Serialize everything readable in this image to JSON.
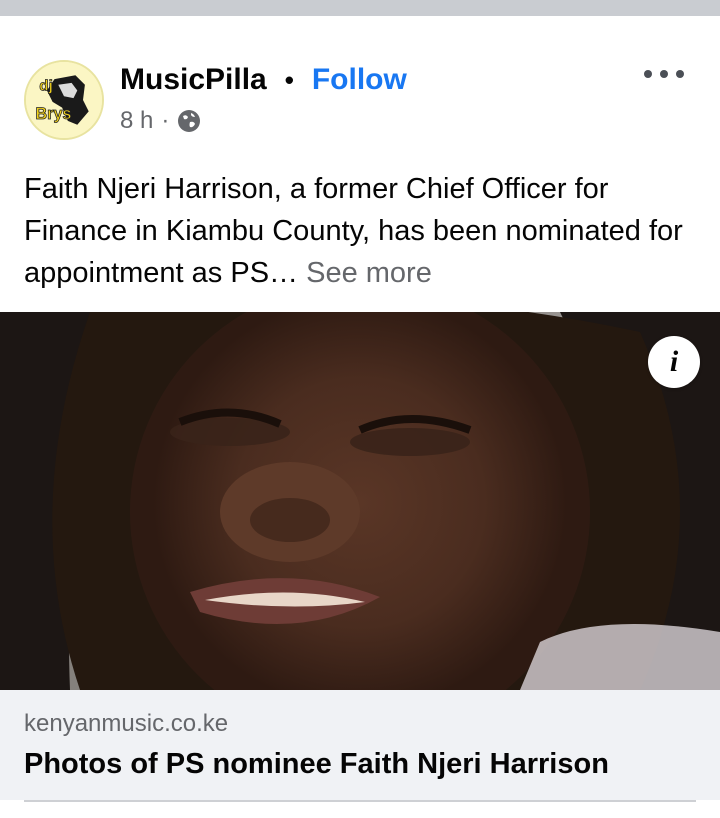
{
  "post": {
    "author": "MusicPilla",
    "separator": "•",
    "follow_label": "Follow",
    "timestamp": "8 h",
    "meta_separator": "·",
    "privacy_icon": "globe-icon",
    "more_icon": "more-horizontal-icon",
    "text": "Faith Njeri Harrison, a former Chief Officer for Finance in Kiambu County, has been nominated for appointment as PS… ",
    "see_more_label": "See more"
  },
  "avatar": {
    "logo_text_top": "dj",
    "logo_text_bottom": "Brys"
  },
  "link_preview": {
    "info_icon_glyph": "i",
    "domain": "kenyanmusic.co.ke",
    "title": "Photos of PS nominee Faith Njeri Harrison"
  },
  "colors": {
    "follow": "#1877f2",
    "secondary_text": "#65676b",
    "footer_bg": "#f0f2f5",
    "divider": "#c9ccd1"
  }
}
